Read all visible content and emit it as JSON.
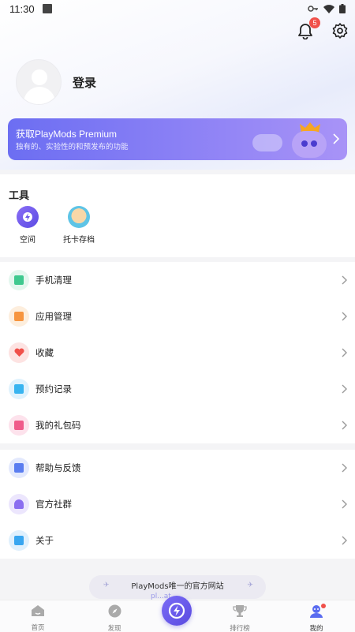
{
  "status_bar": {
    "time": "11:30"
  },
  "header": {
    "notification_count": "5"
  },
  "profile": {
    "login_label": "登录"
  },
  "premium": {
    "title": "获取PlayMods Premium",
    "subtitle": "独有的、实验性的和预发布的功能"
  },
  "tools": {
    "title": "工具",
    "items": [
      {
        "label": "空间",
        "icon": "space-icon"
      },
      {
        "label": "托卡存档",
        "icon": "toca-save-icon"
      }
    ]
  },
  "menu_group_1": [
    {
      "label": "手机清理",
      "icon": "broom-icon",
      "color": "#3fc98f"
    },
    {
      "label": "应用管理",
      "icon": "app-manage-icon",
      "color": "#f7953f"
    },
    {
      "label": "收藏",
      "icon": "heart-icon",
      "color": "#f0504a"
    },
    {
      "label": "预约记录",
      "icon": "calendar-icon",
      "color": "#38b4f0"
    },
    {
      "label": "我的礼包码",
      "icon": "gift-icon",
      "color": "#f05a8a"
    }
  ],
  "menu_group_2": [
    {
      "label": "帮助与反馈",
      "icon": "help-feedback-icon",
      "color": "#5a7df0"
    },
    {
      "label": "官方社群",
      "icon": "community-icon",
      "color": "#8b6ef0"
    },
    {
      "label": "关于",
      "icon": "about-icon",
      "color": "#38a6f0"
    }
  ],
  "banner": {
    "text": "PlayMods唯一的官方网站",
    "subtext": "pl...at"
  },
  "nav": {
    "items": [
      {
        "label": "首页",
        "icon": "home-icon"
      },
      {
        "label": "发现",
        "icon": "compass-icon"
      },
      {
        "label": "",
        "icon": "playmods-logo-icon"
      },
      {
        "label": "排行榜",
        "icon": "trophy-icon"
      },
      {
        "label": "我的",
        "icon": "profile-icon"
      }
    ]
  },
  "colors": {
    "accent": "#6c6ef2",
    "badge": "#f0504a"
  }
}
